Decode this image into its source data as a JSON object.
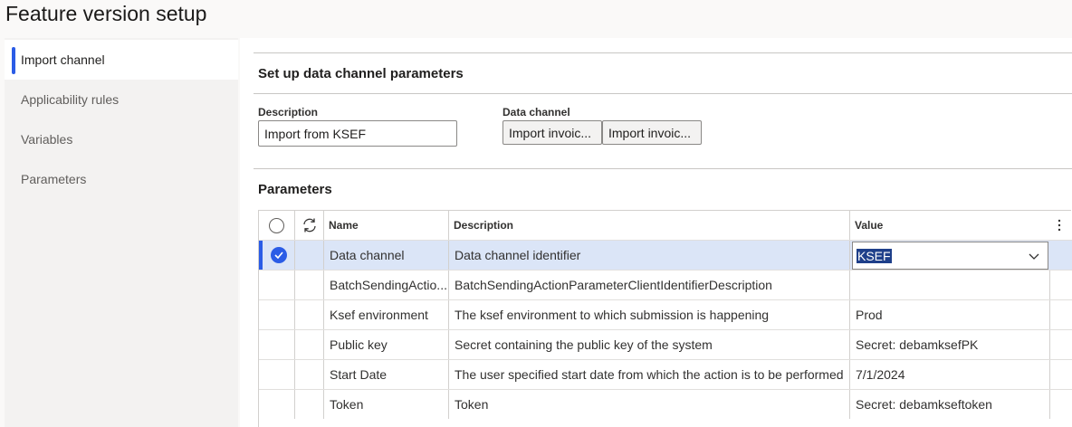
{
  "page": {
    "title": "Feature version setup"
  },
  "nav": {
    "items": [
      {
        "label": "Import channel",
        "active": true
      },
      {
        "label": "Applicability rules"
      },
      {
        "label": "Variables"
      },
      {
        "label": "Parameters"
      }
    ]
  },
  "setup": {
    "title": "Set up data channel parameters",
    "description_label": "Description",
    "description_value": "Import from KSEF",
    "data_channel_label": "Data channel",
    "data_channel_buttons": [
      "Import invoic...",
      "Import invoic..."
    ]
  },
  "parameters": {
    "title": "Parameters",
    "columns": {
      "name": "Name",
      "description": "Description",
      "value": "Value"
    },
    "rows": [
      {
        "name": "Data channel",
        "description": "Data channel identifier",
        "value": "KSEF",
        "selected": true
      },
      {
        "name": "BatchSendingActio...",
        "description": "BatchSendingActionParameterClientIdentifierDescription",
        "value": ""
      },
      {
        "name": "Ksef environment",
        "description": "The ksef environment to which submission is happening",
        "value": "Prod"
      },
      {
        "name": "Public key",
        "description": "Secret containing the public key of the system",
        "value": "Secret: debamksefPK"
      },
      {
        "name": "Start Date",
        "description": "The user specified start date from which the action is to be performed",
        "value": "7/1/2024"
      },
      {
        "name": "Token",
        "description": "Token",
        "value": "Secret: debamkseftoken"
      }
    ]
  },
  "colors": {
    "accent": "#2b5ce6",
    "selected_row": "#dbe5f7"
  }
}
